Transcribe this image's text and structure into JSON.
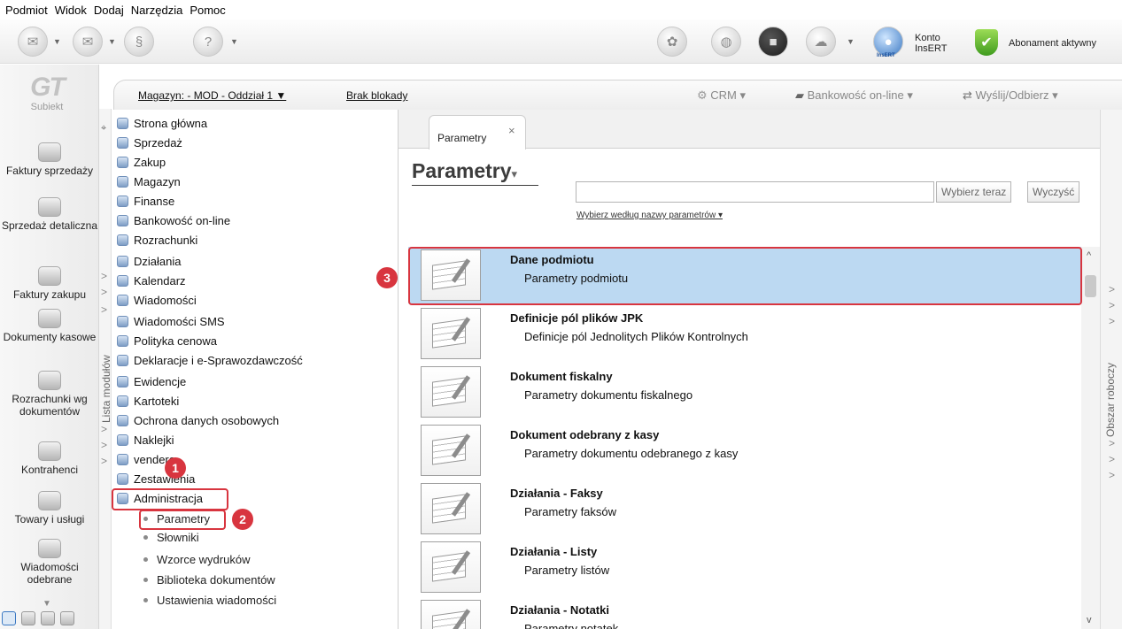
{
  "menu": [
    "Podmiot",
    "Widok",
    "Dodaj",
    "Narzędzia",
    "Pomoc"
  ],
  "toolbar": {
    "konto_line1": "Konto",
    "konto_line2": "InsERT",
    "insert_badge": "InsERT",
    "abonament": "Abonament aktywny"
  },
  "logo": {
    "mark": "GT",
    "name": "Subiekt"
  },
  "leftnav": [
    "Faktury sprzedaży",
    "Sprzedaż detaliczna",
    "Faktury zakupu",
    "Dokumenty kasowe",
    "Rozrachunki wg dokumentów",
    "Kontrahenci",
    "Towary i usługi",
    "Wiadomości odebrane"
  ],
  "context_bar": {
    "magazyn": "Magazyn: - MOD - Oddział 1 ▼",
    "blokada": "Brak blokady",
    "crm": "CRM ▾",
    "bankowosc": "Bankowość on-line ▾",
    "wyslij": "Wyślij/Odbierz ▾"
  },
  "module_strip_label": "Lista modułów",
  "tree": {
    "items": [
      "Strona główna",
      "Sprzedaż",
      "Zakup",
      "Magazyn",
      "Finanse",
      "Bankowość on-line",
      "Rozrachunki",
      "Działania",
      "Kalendarz",
      "Wiadomości",
      "Wiadomości SMS",
      "Polityka cenowa",
      "Deklaracje i e-Sprawozdawczość",
      "Ewidencje",
      "Kartoteki",
      "Ochrona danych osobowych",
      "Naklejki",
      "vendero",
      "Zestawienia",
      "Administracja"
    ],
    "sub_items": [
      "Parametry",
      "Słowniki",
      "Wzorce wydruków",
      "Biblioteka dokumentów",
      "Ustawienia wiadomości"
    ]
  },
  "badges": [
    "1",
    "2",
    "3"
  ],
  "tab": {
    "label": "Parametry",
    "close": "×"
  },
  "page": {
    "title": "Parametry",
    "title_caret": "▾",
    "search_value": "",
    "search_button": "Wybierz teraz",
    "clear_button": "Wyczyść",
    "filter_link": "Wybierz według nazwy parametrów ▾"
  },
  "params": [
    {
      "title": "Dane podmiotu",
      "desc": "Parametry podmiotu"
    },
    {
      "title": "Definicje pól plików JPK",
      "desc": "Definicje pól Jednolitych Plików Kontrolnych"
    },
    {
      "title": "Dokument fiskalny",
      "desc": "Parametry dokumentu fiskalnego"
    },
    {
      "title": "Dokument odebrany z kasy",
      "desc": "Parametry dokumentu odebranego z kasy"
    },
    {
      "title": "Działania - Faksy",
      "desc": "Parametry faksów"
    },
    {
      "title": "Działania - Listy",
      "desc": "Parametry listów"
    },
    {
      "title": "Działania - Notatki",
      "desc": "Parametry notatek"
    }
  ],
  "right_strip_label": "Obszar roboczy",
  "colors": {
    "selection": "#bcd9f2",
    "highlight": "#d8353f",
    "accent_green": "#3f9b1e"
  },
  "icons": [
    "mail-send-icon",
    "mail-receive-icon",
    "subiekt-icon",
    "help-icon",
    "loading-icon",
    "globe-icon",
    "box-icon",
    "cloud-icon",
    "user-icon",
    "shield-check-icon"
  ]
}
